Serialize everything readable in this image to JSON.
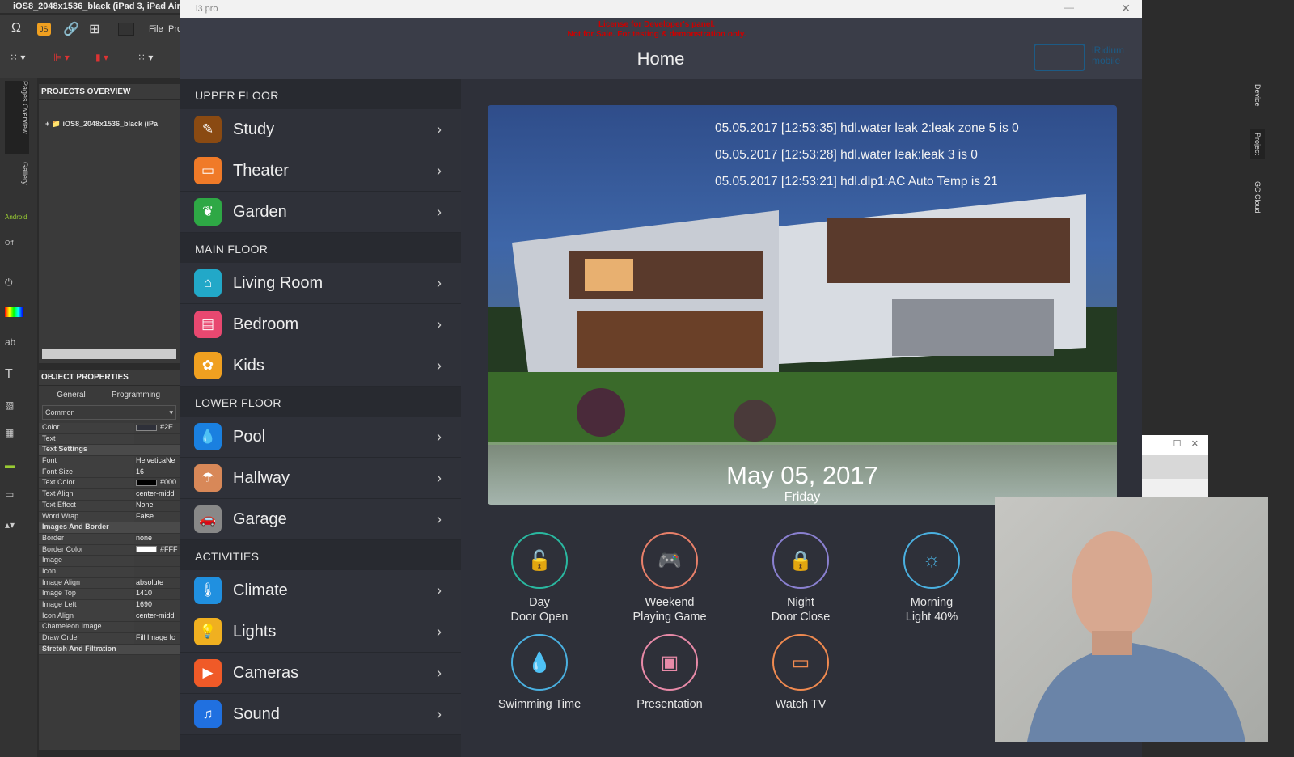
{
  "ide": {
    "title": "iOS8_2048x1536_black (iPad 3, iPad Air, iPad",
    "menu_file": "File",
    "menu_pro": "Pro",
    "projects_title": "PROJECTS OVERVIEW",
    "project_node": "iOS8_2048x1536_black (iPa",
    "props_title": "OBJECT PROPERTIES",
    "tab_general": "General",
    "tab_programming": "Programming",
    "dropdown": "Common",
    "strip": [
      "Pages Overview",
      "Gallery",
      "Android",
      "Off"
    ],
    "right_strip": [
      "Device",
      "Project",
      "GC Cloud"
    ],
    "props": [
      {
        "k": "Color",
        "v": "#2E",
        "swatch": "#2e3039"
      },
      {
        "k": "Text",
        "v": ""
      },
      {
        "k": "Text Settings",
        "section": true
      },
      {
        "k": "Font",
        "v": "HelveticaNe"
      },
      {
        "k": "Font Size",
        "v": "16"
      },
      {
        "k": "Text Color",
        "v": "#000",
        "swatch": "#000000"
      },
      {
        "k": "Text Align",
        "v": "center-middl"
      },
      {
        "k": "Text Effect",
        "v": "None"
      },
      {
        "k": "Word Wrap",
        "v": "False"
      },
      {
        "k": "Images And Border",
        "section": true
      },
      {
        "k": "Border",
        "v": "none"
      },
      {
        "k": "Border Color",
        "v": "#FFF",
        "swatch": "#ffffff"
      },
      {
        "k": "Image",
        "v": ""
      },
      {
        "k": "Icon",
        "v": ""
      },
      {
        "k": "Image Align",
        "v": "absolute"
      },
      {
        "k": "Image Top",
        "v": "1410"
      },
      {
        "k": "Image Left",
        "v": "1690"
      },
      {
        "k": "Icon Align",
        "v": "center-middl"
      },
      {
        "k": "Chameleon Image",
        "v": ""
      },
      {
        "k": "Draw Order",
        "v": "Fill Image Ic"
      },
      {
        "k": "Stretch And Filtration",
        "section": true
      }
    ]
  },
  "app": {
    "window_title": "i3 pro",
    "license_1": "License for Developer's panel.",
    "license_2": "Not for Sale. For testing & demonstration only.",
    "page_title": "Home",
    "logo_1": "iRidium",
    "logo_2": "mobile"
  },
  "sidebar": [
    {
      "header": "UPPER FLOOR",
      "items": [
        {
          "label": "Study",
          "icon": "pencil-icon",
          "color": "#8a4a12",
          "glyph": "✎"
        },
        {
          "label": "Theater",
          "icon": "screen-icon",
          "color": "#f07a28",
          "glyph": "▭"
        },
        {
          "label": "Garden",
          "icon": "plant-icon",
          "color": "#2ea845",
          "glyph": "❦"
        }
      ]
    },
    {
      "header": "MAIN FLOOR",
      "items": [
        {
          "label": "Living Room",
          "icon": "sofa-icon",
          "color": "#22a8c8",
          "glyph": "⌂"
        },
        {
          "label": "Bedroom",
          "icon": "bed-icon",
          "color": "#e84870",
          "glyph": "▤"
        },
        {
          "label": "Kids",
          "icon": "toy-icon",
          "color": "#f0a020",
          "glyph": "✿"
        }
      ]
    },
    {
      "header": "LOWER FLOOR",
      "items": [
        {
          "label": "Pool",
          "icon": "drop-icon",
          "color": "#1a80e0",
          "glyph": "💧"
        },
        {
          "label": "Hallway",
          "icon": "umbrella-icon",
          "color": "#d88858",
          "glyph": "☂"
        },
        {
          "label": "Garage",
          "icon": "car-icon",
          "color": "#888888",
          "glyph": "🚗"
        }
      ]
    },
    {
      "header": "ACTIVITIES",
      "items": [
        {
          "label": "Climate",
          "icon": "thermometer-icon",
          "color": "#2090e0",
          "glyph": "🌡"
        },
        {
          "label": "Lights",
          "icon": "bulb-icon",
          "color": "#f0b020",
          "glyph": "💡"
        },
        {
          "label": "Cameras",
          "icon": "camera-icon",
          "color": "#f05a28",
          "glyph": "▶"
        },
        {
          "label": "Sound",
          "icon": "music-icon",
          "color": "#2070e0",
          "glyph": "♫"
        }
      ]
    }
  ],
  "log": [
    "05.05.2017 [12:53:35] hdl.water leak 2:leak zone 5 is 0",
    "05.05.2017 [12:53:28] hdl.water leak:leak 3 is 0",
    "05.05.2017 [12:53:21] hdl.dlp1:AC Auto Temp is 21"
  ],
  "date": "May 05, 2017",
  "weekday": "Friday",
  "activities": [
    {
      "l1": "Day",
      "l2": "Door Open",
      "icon": "lock-open-icon",
      "glyph": "🔓",
      "color": "#2ab8a0"
    },
    {
      "l1": "Weekend",
      "l2": "Playing Game",
      "icon": "gamepad-icon",
      "glyph": "🎮",
      "color": "#e8806a"
    },
    {
      "l1": "Night",
      "l2": "Door Close",
      "icon": "lock-icon",
      "glyph": "🔒",
      "color": "#8a80d0"
    },
    {
      "l1": "Morning",
      "l2": "Light 40%",
      "icon": "sun-icon",
      "glyph": "☼",
      "color": "#4ab0e0"
    },
    {
      "l1": "Swimming Time",
      "l2": "",
      "icon": "drop-icon",
      "glyph": "💧",
      "color": "#4ab0e0"
    },
    {
      "l1": "Presentation",
      "l2": "",
      "icon": "video-camera-icon",
      "glyph": "▣",
      "color": "#e88aa8"
    },
    {
      "l1": "Watch TV",
      "l2": "",
      "icon": "tv-icon",
      "glyph": "▭",
      "color": "#f08a50"
    }
  ]
}
